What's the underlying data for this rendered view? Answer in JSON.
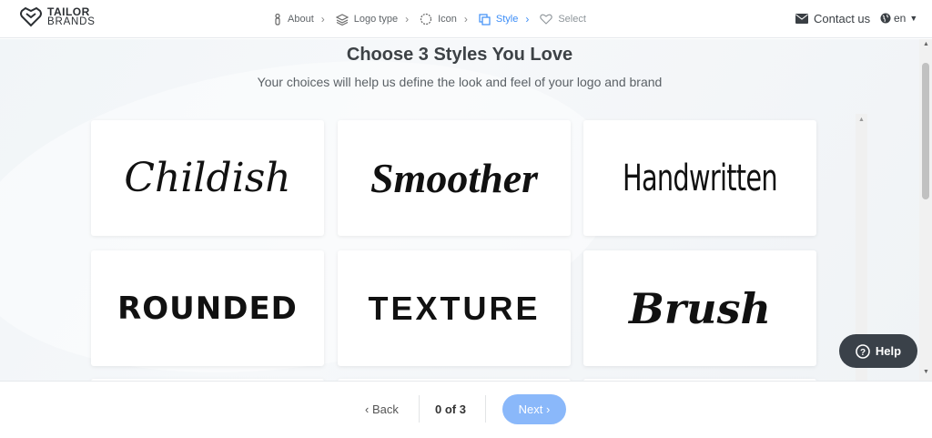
{
  "brand": {
    "name_line1": "TAILOR",
    "name_line2": "BRANDS"
  },
  "steps": [
    {
      "label": "About",
      "icon": "person-icon",
      "state": "done"
    },
    {
      "label": "Logo type",
      "icon": "layers-icon",
      "state": "done"
    },
    {
      "label": "Icon",
      "icon": "badge-icon",
      "state": "done"
    },
    {
      "label": "Style",
      "icon": "copy-icon",
      "state": "active"
    },
    {
      "label": "Select",
      "icon": "heart-icon",
      "state": "disabled"
    }
  ],
  "header": {
    "contact_label": "Contact us",
    "language": "en"
  },
  "main": {
    "title": "Choose 3 Styles You Love",
    "subtitle": "Your choices will help us define the look and feel of your logo and brand"
  },
  "styles": [
    {
      "label": "Childish"
    },
    {
      "label": "Smoother"
    },
    {
      "label": "Handwritten"
    },
    {
      "label": "ROUNDED"
    },
    {
      "label": "TEXTURE"
    },
    {
      "label": "Brush"
    }
  ],
  "help": {
    "label": "Help"
  },
  "footer": {
    "back_label": "Back",
    "counter": "0 of 3",
    "next_label": "Next"
  },
  "colors": {
    "accent": "#3d8ef7",
    "next_button": "#8ab8fa",
    "help_bg": "#3a4149"
  }
}
